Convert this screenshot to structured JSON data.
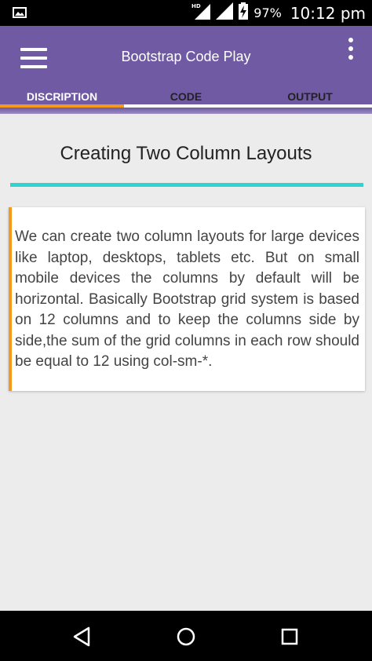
{
  "status_bar": {
    "network_label": "HD",
    "battery_percent": "97%",
    "time": "10:12 pm"
  },
  "app_bar": {
    "title": "Bootstrap Code Play",
    "menu_icon": "hamburger-menu-icon",
    "overflow_icon": "more-vert-icon"
  },
  "tabs": [
    {
      "label": "DISCRIPTION",
      "active": true
    },
    {
      "label": "CODE",
      "active": false
    },
    {
      "label": "OUTPUT",
      "active": false
    }
  ],
  "content": {
    "title": "Creating Two Column Layouts",
    "description": "We can create two column layouts for large devices like laptop, desktops, tablets etc. But on small mobile devices the columns by default will be horizontal. Basically Bootstrap grid system is based on 12 columns and to keep the columns side by side,the sum of the grid columns in each row should be equal to 12 using col-sm-*."
  },
  "nav_bar": {
    "back_icon": "back-triangle-icon",
    "home_icon": "home-circle-icon",
    "recents_icon": "recents-square-icon"
  },
  "colors": {
    "app_bar": "#6f5aa3",
    "tab_indicator": "#f39a1e",
    "title_rule": "#2fd3d0",
    "card_accent": "#f39a1e",
    "background": "#ececec"
  }
}
